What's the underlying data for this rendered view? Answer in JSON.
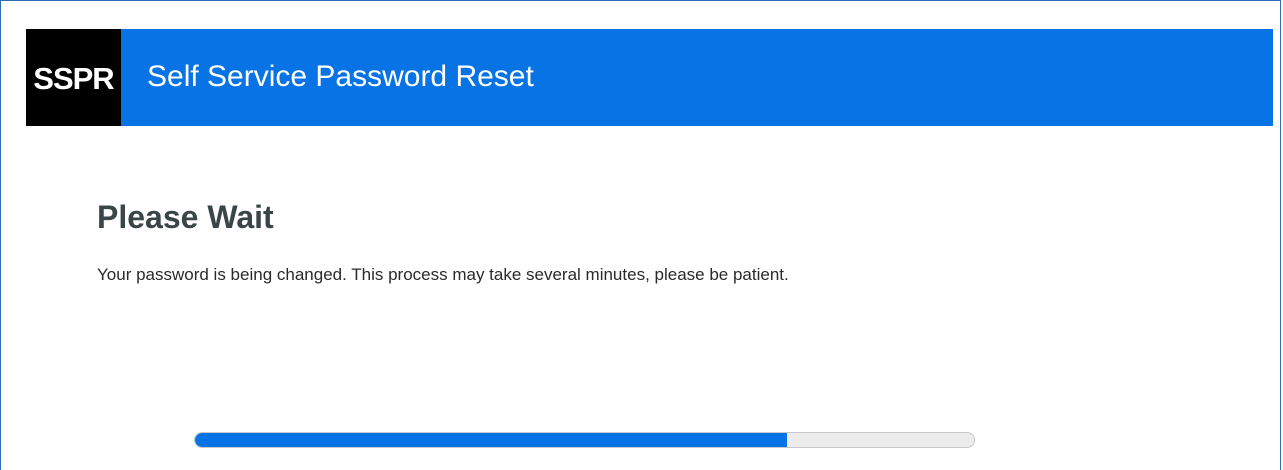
{
  "header": {
    "logo_text": "SSPR",
    "app_title": "Self Service Password Reset"
  },
  "main": {
    "title": "Please Wait",
    "message": "Your password is being changed. This process may take several minutes, please be patient.",
    "progress": {
      "fraction": 0.76
    }
  },
  "colors": {
    "brand_blue": "#0873e4",
    "logo_background": "#000000",
    "title_text": "#3a4548",
    "progress_track": "#ececec"
  }
}
